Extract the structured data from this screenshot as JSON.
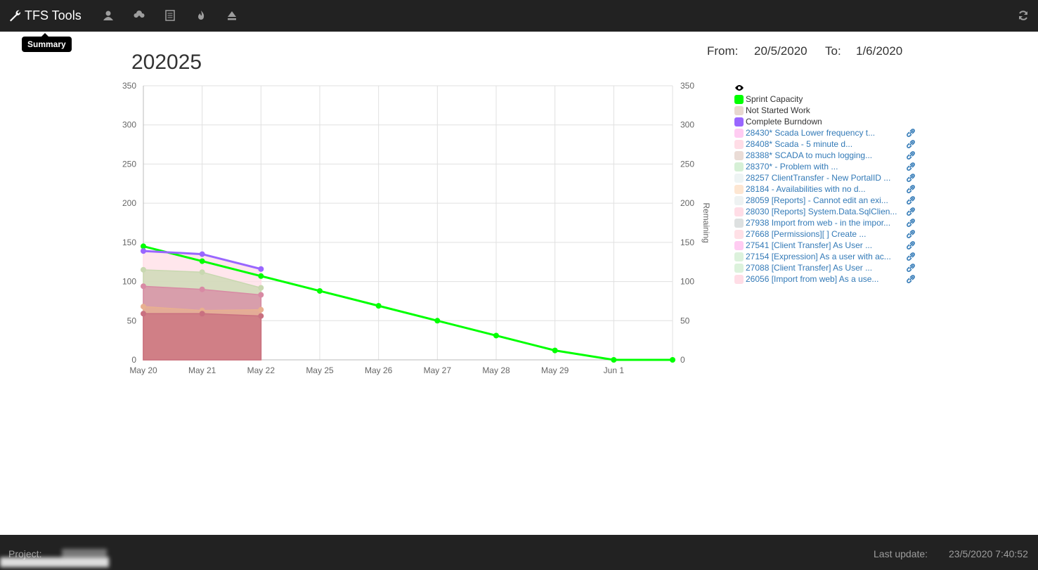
{
  "navbar": {
    "brand": "TFS Tools",
    "icons": [
      "user-icon",
      "cloud-upload-icon",
      "list-icon",
      "fire-icon",
      "eject-icon"
    ],
    "refresh_icon": "refresh-icon",
    "tooltip": "Summary"
  },
  "page": {
    "title": "202025",
    "from_label": "From:",
    "from_value": "20/5/2020",
    "to_label": "To:",
    "to_value": "1/6/2020"
  },
  "legend": {
    "eye_icon": "eye-icon",
    "series": [
      {
        "label": "Sprint Capacity",
        "color": "#00ff00"
      },
      {
        "label": "Not Started Work",
        "color": "#e8d8d0"
      },
      {
        "label": "Complete Burndown",
        "color": "#9966ff"
      }
    ],
    "items": [
      {
        "label": "28430* Scada Lower frequency t...",
        "color": "#ffccf2"
      },
      {
        "label": "28408* Scada - 5 minute d...",
        "color": "#ffdde6"
      },
      {
        "label": "28388* SCADA to much logging...",
        "color": "#eadcd6"
      },
      {
        "label": "28370* - Problem with ...",
        "color": "#d6f0d6"
      },
      {
        "label": "28257 ClientTransfer - New PortalID ...",
        "color": "#eef4f4"
      },
      {
        "label": "28184 - Availabilities with no d...",
        "color": "#fde6d2"
      },
      {
        "label": "28059 [Reports] - Cannot edit an exi...",
        "color": "#eef2f2"
      },
      {
        "label": "28030 [Reports] System.Data.SqlClien...",
        "color": "#ffdde6"
      },
      {
        "label": "27938 Import from web - in the impor...",
        "color": "#dde0e0"
      },
      {
        "label": "27668 [Permissions][ ] Create ...",
        "color": "#ffe0e6"
      },
      {
        "label": "27541 [Client Transfer] As User ...",
        "color": "#ffccf2"
      },
      {
        "label": "27154 [Expression] As a user with ac...",
        "color": "#dcf2dc"
      },
      {
        "label": "27088 [Client Transfer] As User ...",
        "color": "#dcf2dc"
      },
      {
        "label": "26056 [Import from web] As a use...",
        "color": "#ffdde6"
      }
    ]
  },
  "chart_data": {
    "type": "line",
    "categories": [
      "May 20",
      "May 21",
      "May 22",
      "May 25",
      "May 26",
      "May 27",
      "May 28",
      "May 29",
      "Jun 1",
      ""
    ],
    "ylim": [
      0,
      350
    ],
    "y_ticks": [
      "0",
      "50",
      "100",
      "150",
      "200",
      "250",
      "300",
      "350"
    ],
    "right_ylabel": "Remaining",
    "grid": true,
    "series": [
      {
        "name": "Sprint Capacity",
        "color": "#00ff00",
        "type": "line",
        "values": [
          145,
          126,
          107,
          88,
          69,
          50,
          31,
          12,
          0,
          0
        ]
      },
      {
        "name": "Complete Burndown",
        "color": "#9966ff",
        "type": "line",
        "values": [
          139,
          135,
          116
        ]
      }
    ],
    "stacked_areas": [
      {
        "color": "#c97080",
        "values": [
          59,
          59,
          56
        ]
      },
      {
        "color": "#e8b090",
        "values": [
          68,
          63,
          64
        ]
      },
      {
        "color": "#d88aa4",
        "values": [
          94,
          90,
          83
        ]
      },
      {
        "color": "#c8d8b0",
        "values": [
          115,
          112,
          92
        ]
      },
      {
        "color": "#ffdde6",
        "values": [
          139,
          135,
          116
        ]
      }
    ]
  },
  "footer": {
    "project_label": "Project:",
    "last_update_label": "Last update:",
    "last_update_value": "23/5/2020 7:40:52"
  }
}
